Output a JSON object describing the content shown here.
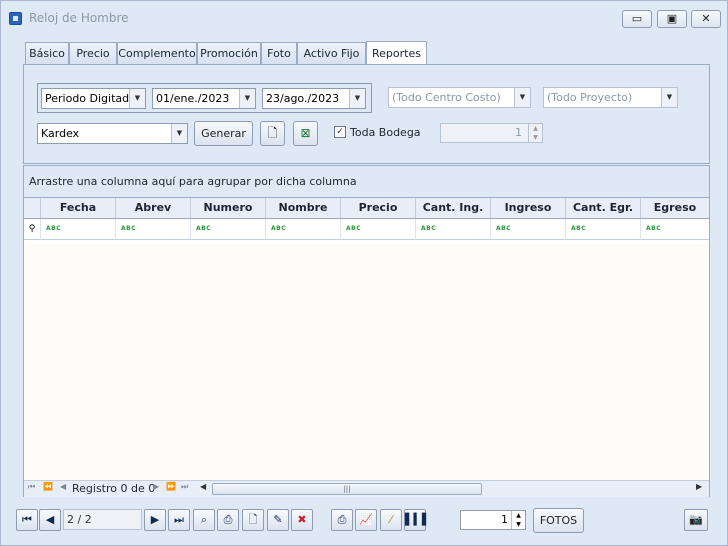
{
  "window": {
    "title": "Reloj de Hombre",
    "buttons": {
      "minimize": "▭",
      "maximize": "▣",
      "close": "✕"
    }
  },
  "tabs": [
    "Básico",
    "Precio",
    "Complemento",
    "Promoción",
    "Foto",
    "Activo Fijo",
    "Reportes"
  ],
  "active_tab": "Reportes",
  "filters": {
    "period_type": "Periodo Digitado",
    "date_from": "01/ene./2023",
    "date_to": "23/ago./2023",
    "cost_center": "(Todo Centro Costo)",
    "project": "(Todo Proyecto)",
    "report": "Kardex",
    "generate_label": "Generar",
    "all_warehouse_label": "Toda Bodega",
    "all_warehouse_checked": true,
    "warehouse_value": "1"
  },
  "grid": {
    "group_hint": "Arrastre una columna aquí para agrupar por dicha columna",
    "columns": [
      "Fecha",
      "Abrev",
      "Numero",
      "Nombre",
      "Precio",
      "Cant. Ing.",
      "Ingreso",
      "Cant. Egr.",
      "Egreso"
    ],
    "filter_icon": "ABC",
    "navigator_text": "Registro 0 de 0"
  },
  "bottom_bar": {
    "pager": "2 / 2",
    "quantity": "1",
    "photos_label": "FOTOS"
  },
  "colors": {
    "background": "#dfe8f5",
    "border": "#9aabc5",
    "accent": "#2a65b8"
  }
}
